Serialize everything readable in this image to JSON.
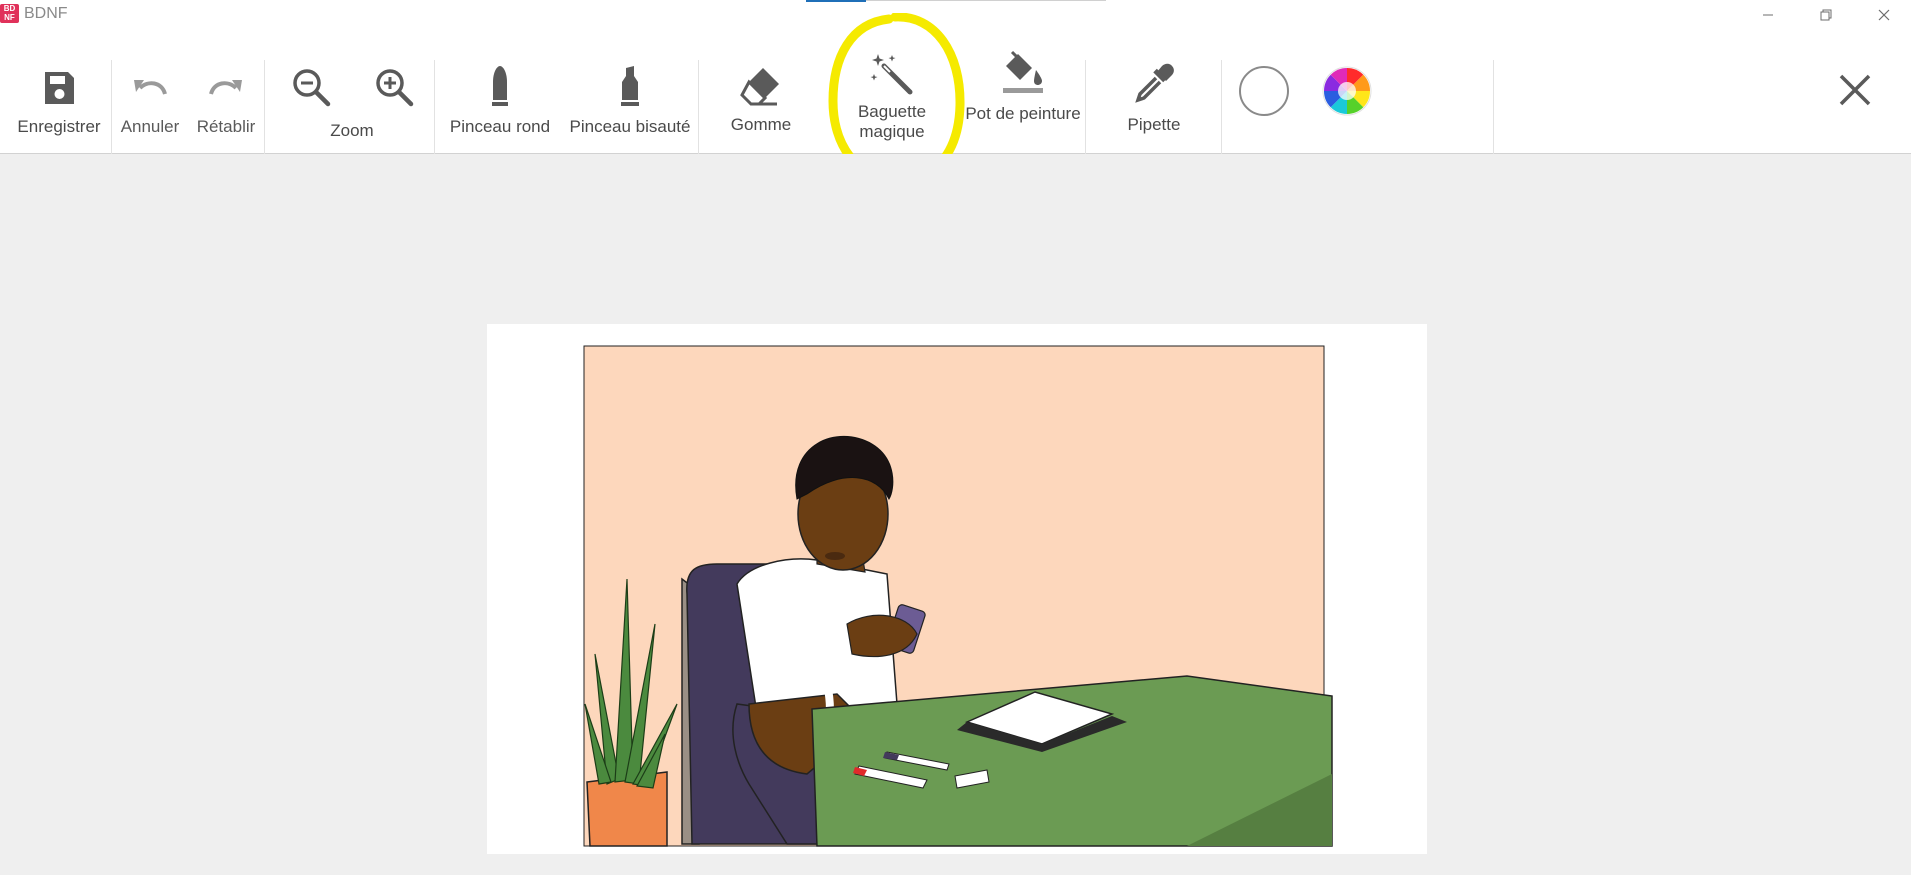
{
  "window": {
    "title": "BDNF",
    "logo_text": "BD NF",
    "controls": [
      "minimize-icon",
      "restore-icon",
      "close-icon"
    ]
  },
  "toolbar": {
    "save_label": "Enregistrer",
    "undo_label": "Annuler",
    "redo_label": "Rétablir",
    "zoom_label": "Zoom",
    "round_brush_label": "Pinceau rond",
    "bevel_brush_label": "Pinceau bisauté",
    "eraser_label": "Gomme",
    "magic_wand_label_line1": "Baguette",
    "magic_wand_label_line2": "magique",
    "paint_bucket_label": "Pot de peinture",
    "eyedropper_label": "Pipette"
  },
  "colors": {
    "accent_tab": "#1f6fb8",
    "highlight": "#f5ea00",
    "icon_gray": "#5a5a5a",
    "skin_bg": "#fdd7bc",
    "table_green": "#6b9b53",
    "chair_purple": "#433a5c",
    "pot_orange": "#f0874a"
  },
  "canvas": {
    "image_description": "Woman seated at a green-draped desk looking at a phone, open book, pens and eraser, plant in an orange pot, peach background"
  }
}
